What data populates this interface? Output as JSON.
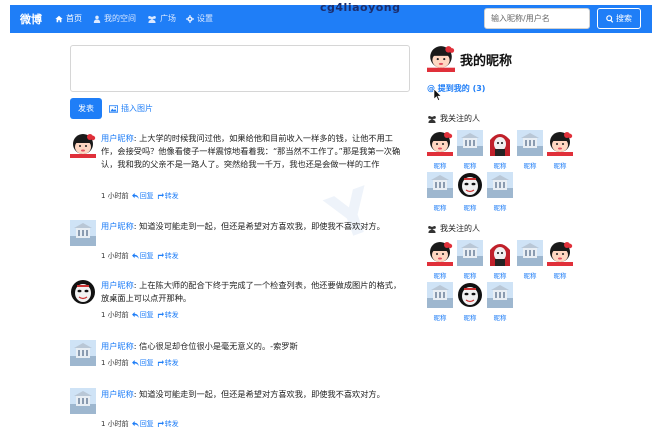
{
  "nav": {
    "brand": "微博",
    "items": [
      {
        "label": "首页",
        "icon": "home-icon",
        "active": true
      },
      {
        "label": "我的空间",
        "icon": "user-icon",
        "active": false
      },
      {
        "label": "广场",
        "icon": "users-icon",
        "active": false
      },
      {
        "label": "设置",
        "icon": "gear-icon",
        "active": false
      }
    ],
    "watermark": "cg4liaoyong",
    "search_placeholder": "输入昵称/用户名",
    "search_label": "搜索"
  },
  "composer": {
    "post_label": "发表",
    "insert_image_label": "插入图片"
  },
  "feed": [
    {
      "user": "用户昵称",
      "text": ": 上大学的时候我问过他，如果给他和目前收入一样多的钱，让他不用工作，会接受吗？他像看傻子一样震惊地看着我：“那当然不工作了。”那是我第一次确认，我和我的父亲不是一路人了。突然给我一千万，我也还是会做一样的工作",
      "time": "1 小时前",
      "reply": "回复",
      "forward": "转发",
      "avatar": "girl"
    },
    {
      "user": "用户昵称",
      "text": ": 知道没可能走到一起，但还是希望对方喜欢我，即使我不喜欢对方。",
      "time": "1 小时前",
      "reply": "回复",
      "forward": "转发",
      "avatar": "building"
    },
    {
      "user": "用户昵称",
      "text": ": 上在陈大师的配合下终于完成了一个检查列表，他还要做成图片的格式，放桌面上可以点开那种。",
      "time": "1 小时前",
      "reply": "回复",
      "forward": "转发",
      "avatar": "mask"
    },
    {
      "user": "用户昵称",
      "text": ": 信心很足却仓位很小是毫无意义的。-索罗斯",
      "time": "1 小时前",
      "reply": "回复",
      "forward": "转发",
      "avatar": "building"
    },
    {
      "user": "用户昵称",
      "text": ": 知道没可能走到一起，但还是希望对方喜欢我，即使我不喜欢对方。",
      "time": "1 小时前",
      "reply": "回复",
      "forward": "转发",
      "avatar": "building"
    }
  ],
  "sidebar": {
    "name": "我的昵称",
    "mention": "@ 提到我的 (3)",
    "follow_groups": [
      {
        "title": "我关注的人",
        "members": [
          {
            "label": "昵称",
            "avatar": "girl"
          },
          {
            "label": "昵称",
            "avatar": "building"
          },
          {
            "label": "昵称",
            "avatar": "redhood"
          },
          {
            "label": "昵称",
            "avatar": "building"
          },
          {
            "label": "昵称",
            "avatar": "girl"
          },
          {
            "label": "昵称",
            "avatar": "building"
          },
          {
            "label": "昵称",
            "avatar": "mask"
          },
          {
            "label": "昵称",
            "avatar": "building"
          }
        ]
      },
      {
        "title": "我关注的人",
        "members": [
          {
            "label": "昵称",
            "avatar": "girl"
          },
          {
            "label": "昵称",
            "avatar": "building"
          },
          {
            "label": "昵称",
            "avatar": "redhood"
          },
          {
            "label": "昵称",
            "avatar": "building"
          },
          {
            "label": "昵称",
            "avatar": "girl"
          },
          {
            "label": "昵称",
            "avatar": "building"
          },
          {
            "label": "昵称",
            "avatar": "mask"
          },
          {
            "label": "昵称",
            "avatar": "building"
          }
        ]
      }
    ]
  },
  "colors": {
    "primary": "#1f7ef7",
    "nav_bg": "#1f7ef7",
    "link": "#1f7ef7"
  }
}
